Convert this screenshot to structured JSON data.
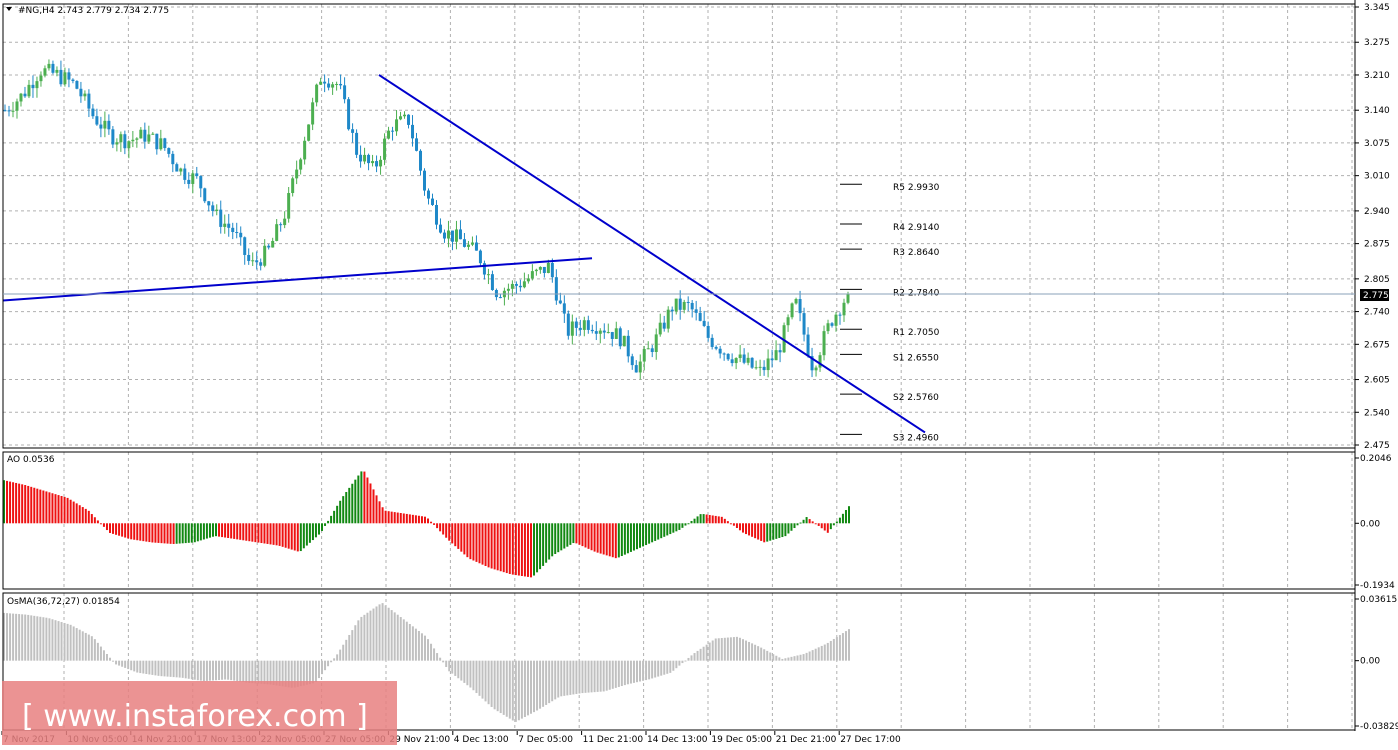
{
  "header": {
    "title": "#NG,H4  2.743 2.779 2.734 2.775"
  },
  "colors": {
    "bull": "#4caf50",
    "bear": "#1e88c8",
    "trend": "#0000cc",
    "ao_up": "#118811",
    "ao_down": "#ee1111",
    "osma": "#c0c0c0",
    "grid": "#b0b0b0",
    "price_marker_bg": "#000000",
    "watermark_bg": "#e88080"
  },
  "price_marker": "2.775",
  "watermark": {
    "text": "[ www.instaforex.com ]"
  },
  "chart_data": [
    {
      "type": "candlestick",
      "title": "#NG,H4  2.743 2.779 2.734 2.775",
      "symbol": "#NG",
      "timeframe": "H4",
      "last_bar": {
        "open": 2.743,
        "high": 2.779,
        "low": 2.734,
        "close": 2.775
      },
      "ylim": [
        2.475,
        3.345
      ],
      "yticks": [
        "3.345",
        "3.275",
        "3.210",
        "3.140",
        "3.075",
        "3.010",
        "2.940",
        "2.875",
        "2.805",
        "2.740",
        "2.675",
        "2.605",
        "2.540",
        "2.475"
      ],
      "xticks": [
        "7 Nov 2017",
        "10 Nov 05:00",
        "14 Nov 21:00",
        "17 Nov 13:00",
        "22 Nov 05:00",
        "27 Nov 05:00",
        "29 Nov 21:00",
        "4 Dec 13:00",
        "7 Dec 05:00",
        "11 Dec 21:00",
        "14 Dec 13:00",
        "19 Dec 05:00",
        "21 Dec 21:00",
        "27 Dec 17:00"
      ],
      "grid": true,
      "close_path": [
        3.14,
        3.17,
        3.22,
        3.21,
        3.19,
        3.13,
        3.09,
        3.08,
        3.09,
        3.07,
        3.02,
        3.0,
        2.93,
        2.9,
        2.83,
        2.86,
        2.94,
        3.08,
        3.21,
        3.19,
        3.06,
        3.02,
        3.11,
        3.12,
        2.97,
        2.9,
        2.88,
        2.85,
        2.78,
        2.79,
        2.81,
        2.83,
        2.7,
        2.72,
        2.71,
        2.69,
        2.63,
        2.68,
        2.75,
        2.75,
        2.69,
        2.66,
        2.64,
        2.62,
        2.66,
        2.76,
        2.63,
        2.72,
        2.775
      ],
      "levels": [
        {
          "label": "R5",
          "value": "2.9930"
        },
        {
          "label": "R4",
          "value": "2.9140"
        },
        {
          "label": "R3",
          "value": "2.8640"
        },
        {
          "label": "R2",
          "value": "2.7840"
        },
        {
          "label": "R1",
          "value": "2.7050"
        },
        {
          "label": "S1",
          "value": "2.6550"
        },
        {
          "label": "S2",
          "value": "2.5760"
        },
        {
          "label": "S3",
          "value": "2.4960"
        }
      ],
      "trendlines": [
        {
          "name": "descending",
          "from": {
            "bar": "29 Nov",
            "price": 3.21
          },
          "to": {
            "bar": "28 Dec",
            "price": 2.5
          }
        },
        {
          "name": "ascending",
          "from": {
            "bar": "7 Nov",
            "price": 2.76
          },
          "to": {
            "bar": "11 Dec",
            "price": 2.84
          }
        }
      ]
    },
    {
      "type": "bar",
      "title": "AO 0.0536",
      "ylim": [
        -0.1934,
        0.2046
      ],
      "yticks": [
        "0.2046",
        "0.00",
        "-0.1934"
      ],
      "values": [
        0.135,
        0.12,
        0.1,
        0.08,
        0.04,
        -0.03,
        -0.05,
        -0.06,
        -0.065,
        -0.06,
        -0.04,
        -0.05,
        -0.06,
        -0.07,
        -0.09,
        -0.03,
        0.08,
        0.17,
        0.04,
        0.03,
        0.02,
        -0.05,
        -0.11,
        -0.14,
        -0.16,
        -0.17,
        -0.1,
        -0.06,
        -0.09,
        -0.11,
        -0.08,
        -0.05,
        -0.02,
        0.03,
        0.02,
        -0.03,
        -0.06,
        -0.04,
        0.02,
        -0.03,
        0.0536
      ]
    },
    {
      "type": "bar",
      "title": "OsMA(36,72,27) 0.01854",
      "ylim": [
        -0.03829,
        0.03615
      ],
      "yticks": [
        "0.03615",
        "0.00",
        "-0.03829"
      ],
      "values": [
        0.028,
        0.027,
        0.025,
        0.021,
        0.014,
        -0.002,
        -0.007,
        -0.009,
        -0.01,
        -0.012,
        -0.011,
        -0.013,
        -0.014,
        -0.016,
        -0.013,
        0.004,
        0.025,
        0.034,
        0.024,
        0.014,
        -0.006,
        -0.016,
        -0.028,
        -0.036,
        -0.029,
        -0.021,
        -0.019,
        -0.018,
        -0.014,
        -0.011,
        -0.007,
        0.004,
        0.013,
        0.014,
        0.008,
        0.001,
        0.004,
        0.01,
        0.0185
      ]
    }
  ]
}
